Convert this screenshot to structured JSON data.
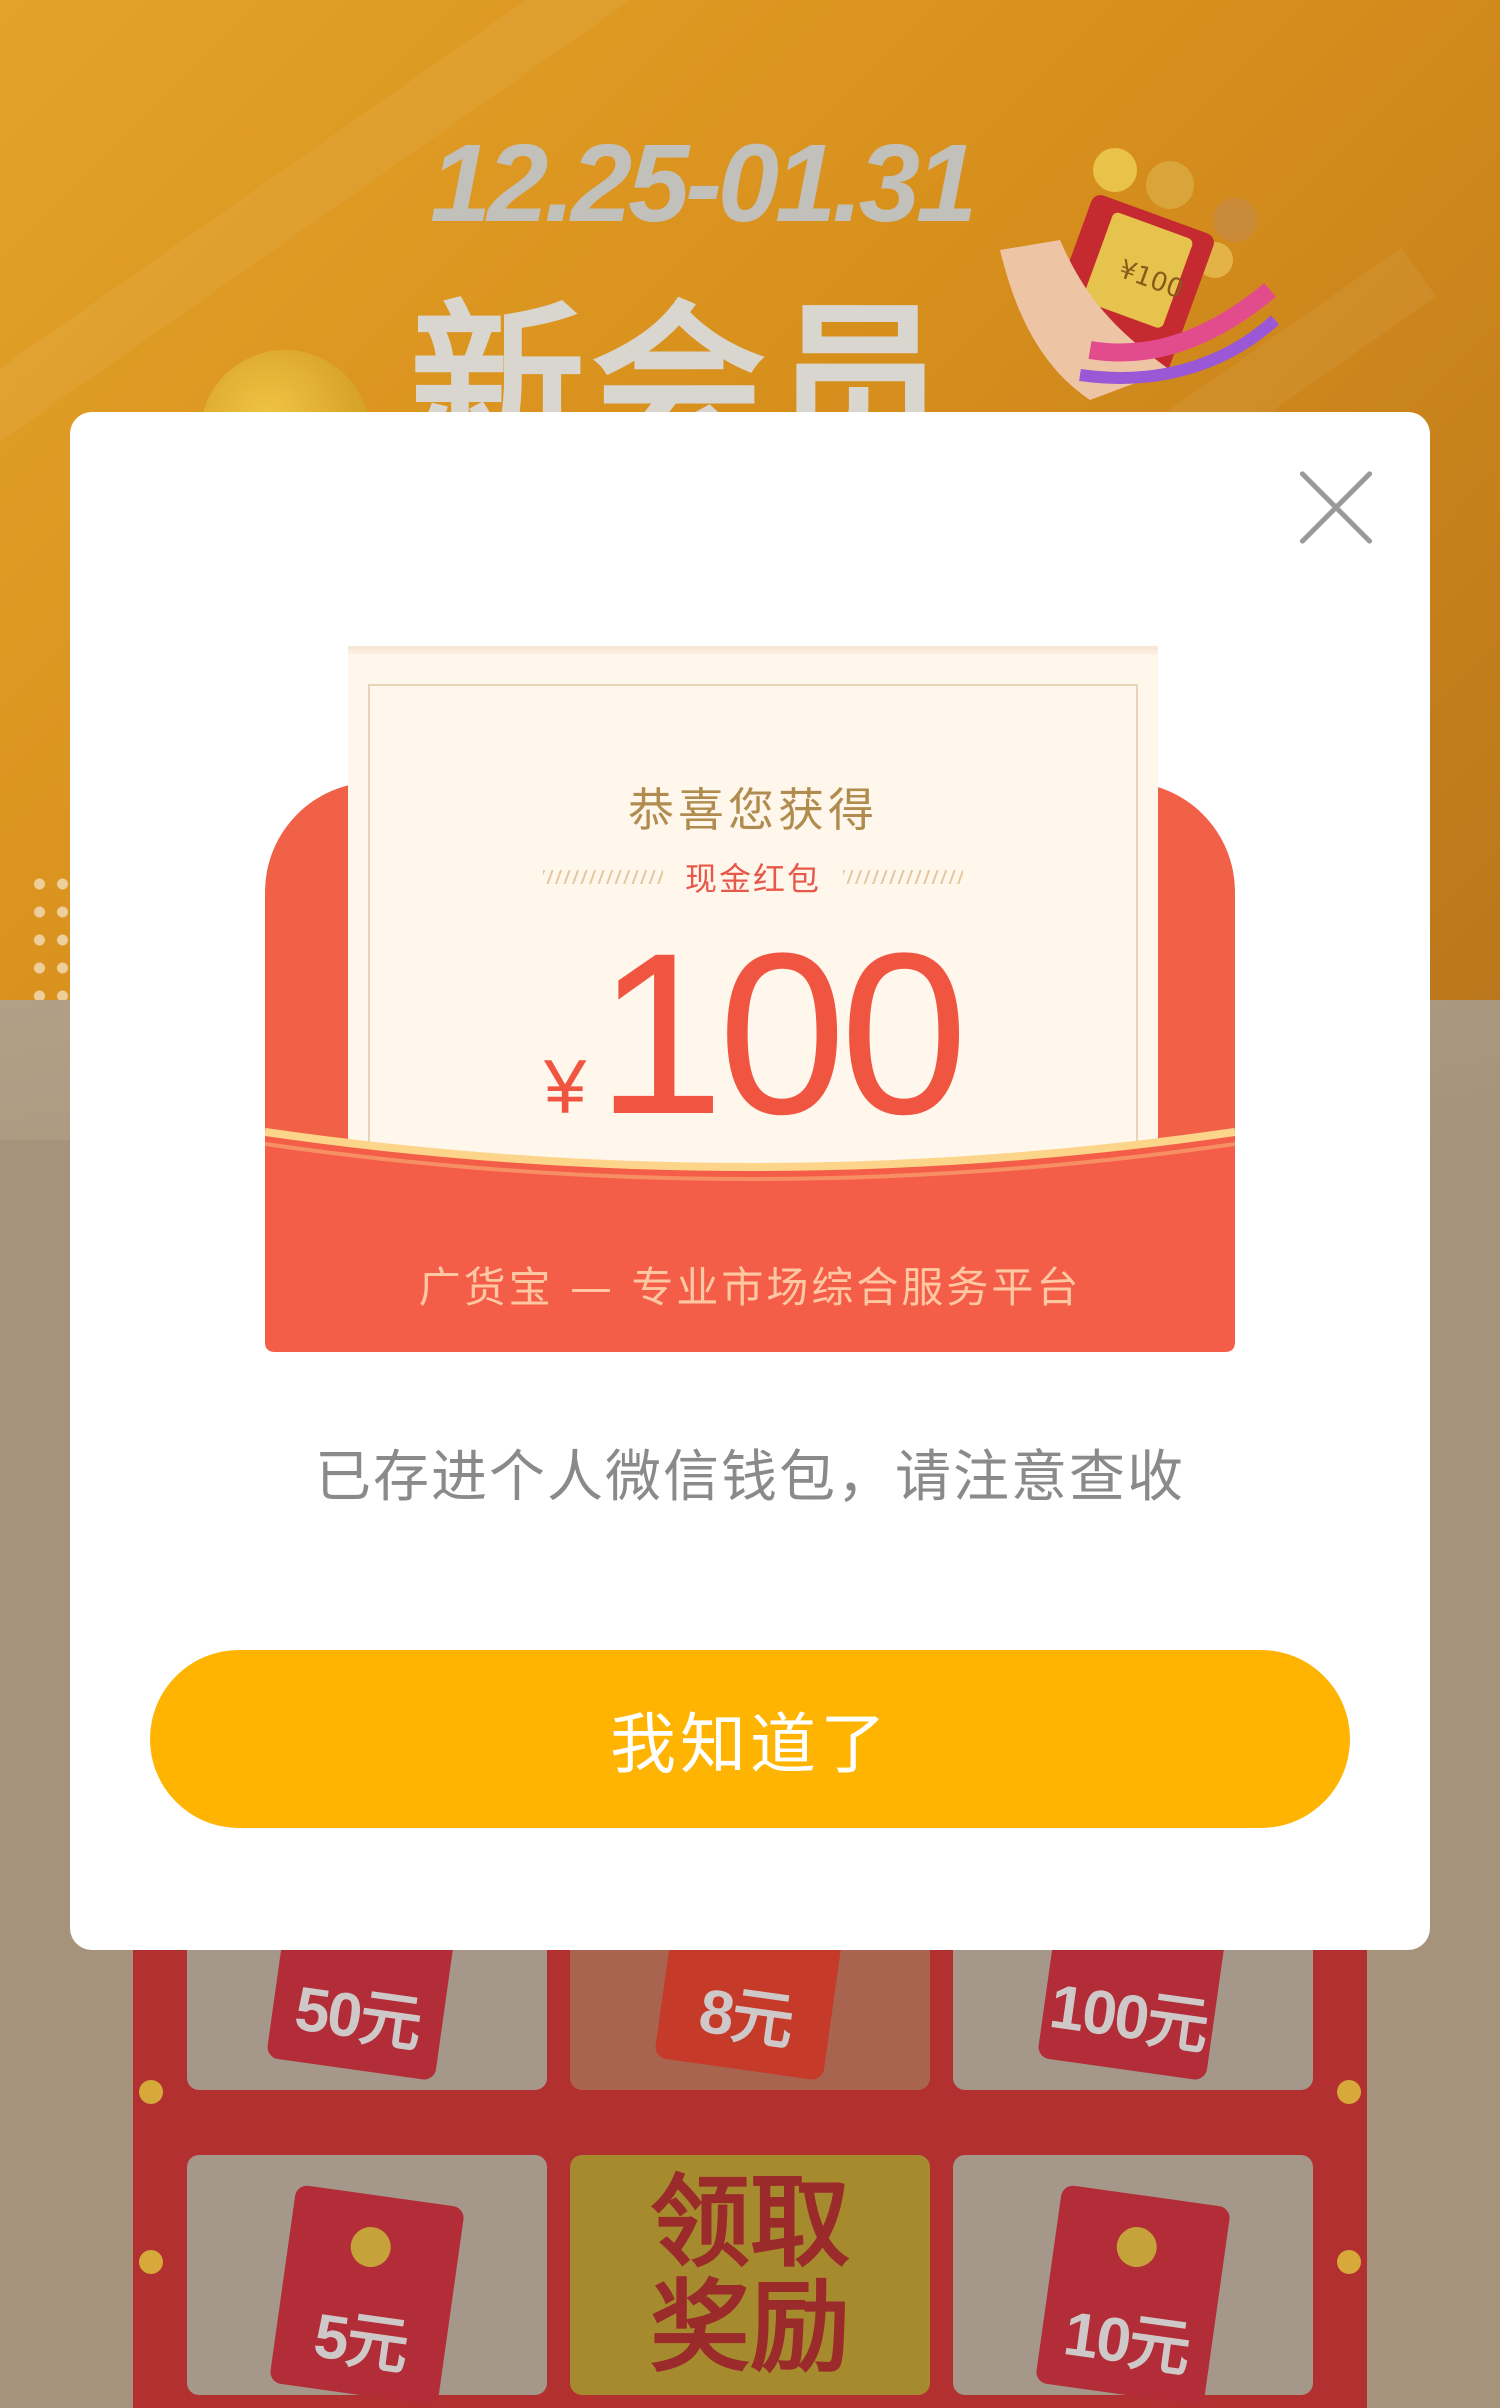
{
  "background": {
    "date_range": "12.25-01.31",
    "headline": "新会员",
    "hand_card_value": "¥100",
    "prizes": [
      {
        "label": "50元"
      },
      {
        "label": "8元"
      },
      {
        "label": "100元"
      },
      {
        "label": "5元"
      },
      {
        "label": "10元"
      }
    ],
    "claim_button": "领取\n奖励"
  },
  "modal": {
    "congrats": "恭喜您获得",
    "cash_label": "现金红包",
    "currency": "¥",
    "amount": "100",
    "tagline": "广货宝 — 专业市场综合服务平台",
    "notice": "已存进个人微信钱包，请注意查收",
    "confirm_button": "我知道了",
    "close_icon": "close-icon"
  },
  "colors": {
    "accent_yellow": "#feb400",
    "envelope_red": "#f06148",
    "amount_red": "#ef5540",
    "gold_text": "#b08c4f"
  }
}
